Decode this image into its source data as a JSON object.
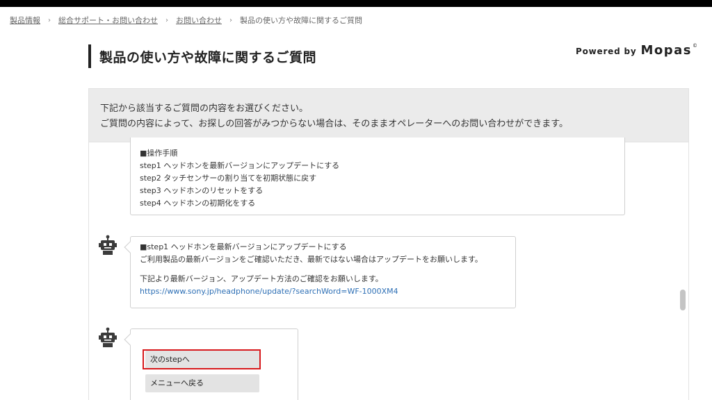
{
  "breadcrumb": {
    "items": [
      "製品情報",
      "総合サポート・お問い合わせ",
      "お問い合わせ",
      "製品の使い方や故障に関するご質問"
    ],
    "separator": "›"
  },
  "page": {
    "title": "製品の使い方や故障に関するご質問",
    "powered_by": "Powered by",
    "brand": "Mopas",
    "brand_mark": "©"
  },
  "intro": {
    "line1": "下記から該当するご質問の内容をお選びください。",
    "line2": "ご質問の内容によって、お探しの回答がみつからない場合は、そのままオペレーターへのお問い合わせができます。"
  },
  "chat": {
    "message1": {
      "lines": [
        "■操作手順",
        "step1 ヘッドホンを最新バージョンにアップデートにする",
        "step2 タッチセンサーの割り当てを初期状態に戻す",
        "step3 ヘッドホンのリセットをする",
        "step4 ヘッドホンの初期化をする"
      ]
    },
    "message2": {
      "line1": "■step1 ヘッドホンを最新バージョンにアップデートにする",
      "line2": "ご利用製品の最新バージョンをご確認いただき、最新ではない場合はアップデートをお願いします。",
      "line3": "下記より最新バージョン、アップデート方法のご確認をお願いします。",
      "link": "https://www.sony.jp/headphone/update/?searchWord=WF-1000XM4"
    },
    "choices": {
      "next": "次のstepへ",
      "menu": "メニューへ戻る"
    }
  },
  "colors": {
    "highlight": "#d7191c",
    "link": "#2d6fb5",
    "intro_bg": "#ebebeb"
  }
}
